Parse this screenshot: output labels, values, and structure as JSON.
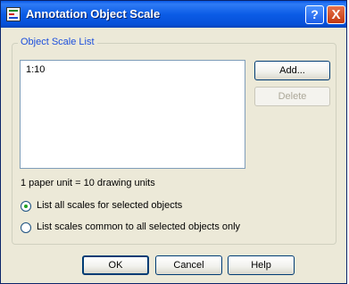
{
  "window": {
    "title": "Annotation Object Scale",
    "help_glyph": "?",
    "close_glyph": "X"
  },
  "group": {
    "legend": "Object Scale List"
  },
  "scale_list": {
    "items": [
      "1:10"
    ]
  },
  "buttons": {
    "add": "Add...",
    "delete": "Delete",
    "ok": "OK",
    "cancel": "Cancel",
    "help": "Help"
  },
  "info_text": "1 paper unit = 10 drawing units",
  "options": [
    {
      "label": "List all scales for selected objects",
      "selected": true
    },
    {
      "label": "List scales common to all selected objects only",
      "selected": false
    }
  ],
  "colors": {
    "titlebar": "#0b5ce6",
    "dialog_bg": "#ece9d8",
    "legend_text": "#1c4fdc",
    "radio_dot": "#21a121"
  }
}
